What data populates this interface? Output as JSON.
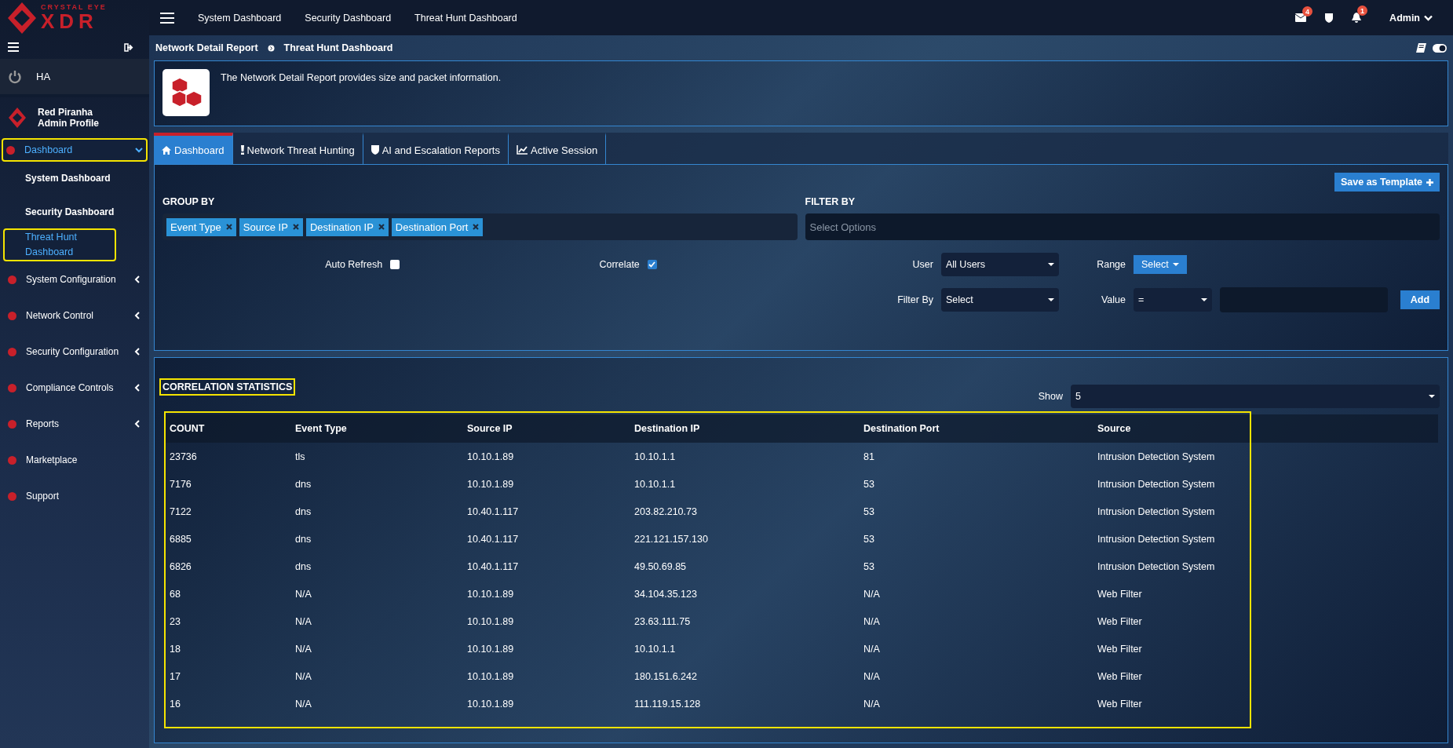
{
  "brand": {
    "tagline": "CRYSTAL EYE",
    "name": "XDR"
  },
  "topnav": {
    "links": [
      "System Dashboard",
      "Security Dashboard",
      "Threat Hunt Dashboard"
    ],
    "mail_count": "4",
    "alert_count": "1",
    "user": "Admin"
  },
  "sidebar": {
    "ha_label": "HA",
    "profile": {
      "name": "Red Piranha",
      "role": "Admin Profile"
    },
    "items": [
      {
        "label": "Dashboard",
        "expanded": true,
        "selected": true,
        "highlighted": true,
        "children": [
          {
            "label": "System Dashboard",
            "selected": false,
            "highlighted": false
          },
          {
            "label": "Security Dashboard",
            "selected": false,
            "highlighted": false
          },
          {
            "label": "Threat Hunt Dashboard",
            "selected": true,
            "highlighted": true
          }
        ]
      },
      {
        "label": "System Configuration",
        "expanded": false,
        "selected": false,
        "highlighted": false
      },
      {
        "label": "Network Control",
        "expanded": false,
        "selected": false,
        "highlighted": false
      },
      {
        "label": "Security Configuration",
        "expanded": false,
        "selected": false,
        "highlighted": false
      },
      {
        "label": "Compliance Controls",
        "expanded": false,
        "selected": false,
        "highlighted": false
      },
      {
        "label": "Reports",
        "expanded": false,
        "selected": false,
        "highlighted": false
      },
      {
        "label": "Marketplace",
        "selected": false,
        "highlighted": false
      },
      {
        "label": "Support",
        "selected": false,
        "highlighted": false
      }
    ]
  },
  "breadcrumb": [
    "Network Detail Report",
    "Threat Hunt Dashboard"
  ],
  "info": "The Network Detail Report provides size and packet information.",
  "tabs": [
    {
      "label": "Dashboard",
      "selected": true
    },
    {
      "label": "Network Threat Hunting",
      "selected": false
    },
    {
      "label": "AI and Escalation Reports",
      "selected": false
    },
    {
      "label": "Active Session",
      "selected": false
    }
  ],
  "filters": {
    "save_button": "Save as Template",
    "group_by_title": "GROUP BY",
    "group_by_tags": [
      "Event Type",
      "Source IP",
      "Destination IP",
      "Destination Port"
    ],
    "filter_by_title": "FILTER BY",
    "filter_placeholder": "Select Options",
    "auto_refresh": {
      "label": "Auto Refresh",
      "checked": false
    },
    "correlate": {
      "label": "Correlate",
      "checked": true
    },
    "user_label": "User",
    "user_value": "All Users",
    "range_label": "Range",
    "range_button": "Select",
    "filter_by_label": "Filter By",
    "filter_by_value": "Select",
    "value_label": "Value",
    "operator": "=",
    "add_button": "Add"
  },
  "stats": {
    "title": "CORRELATION STATISTICS",
    "highlighted": true,
    "show_label": "Show",
    "show_value": "5",
    "table": {
      "highlighted": true,
      "columns": [
        "COUNT",
        "Event Type",
        "Source IP",
        "Destination IP",
        "Destination Port",
        "Source"
      ],
      "rows": [
        [
          "23736",
          "tls",
          "10.10.1.89",
          "10.10.1.1",
          "81",
          "Intrusion Detection System"
        ],
        [
          "7176",
          "dns",
          "10.10.1.89",
          "10.10.1.1",
          "53",
          "Intrusion Detection System"
        ],
        [
          "7122",
          "dns",
          "10.40.1.117",
          "203.82.210.73",
          "53",
          "Intrusion Detection System"
        ],
        [
          "6885",
          "dns",
          "10.40.1.117",
          "221.121.157.130",
          "53",
          "Intrusion Detection System"
        ],
        [
          "6826",
          "dns",
          "10.40.1.117",
          "49.50.69.85",
          "53",
          "Intrusion Detection System"
        ],
        [
          "68",
          "N/A",
          "10.10.1.89",
          "34.104.35.123",
          "N/A",
          "Web Filter"
        ],
        [
          "23",
          "N/A",
          "10.10.1.89",
          "23.63.111.75",
          "N/A",
          "Web Filter"
        ],
        [
          "18",
          "N/A",
          "10.10.1.89",
          "10.10.1.1",
          "N/A",
          "Web Filter"
        ],
        [
          "17",
          "N/A",
          "10.10.1.89",
          "180.151.6.242",
          "N/A",
          "Web Filter"
        ],
        [
          "16",
          "N/A",
          "10.10.1.89",
          "111.119.15.128",
          "N/A",
          "Web Filter"
        ]
      ]
    }
  }
}
